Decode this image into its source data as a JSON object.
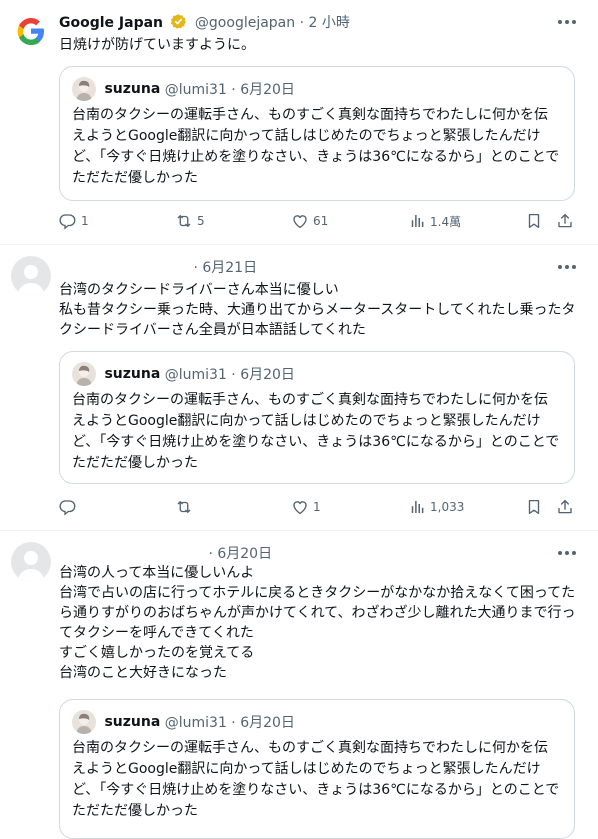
{
  "tweets": [
    {
      "author": "Google Japan",
      "meta": "@googlejapan · 2 小時",
      "text": "日焼けが防げていますように。",
      "quote": {
        "name": "suzuna",
        "meta": "@lumi31 · 6月20日",
        "text": "台南のタクシーの運転手さん、ものすごく真剣な面持ちでわたしに何かを伝えようとGoogle翻訳に向かって話しはじめたのでちょっと緊張したんだけど、「今すぐ日焼け止めを塗りなさい、きょうは36℃になるから」とのことでただただ優しかった"
      },
      "actions": {
        "replies": "1",
        "reposts": "5",
        "likes": "61",
        "views": "1.4萬"
      }
    },
    {
      "meta": "· 6月21日",
      "text": "台湾のタクシードライバーさん本当に優しい\n私も昔タクシー乗った時、大通り出てからメータースタートしてくれたし乗ったタクシードライバーさん全員が日本語話してくれた",
      "quote": {
        "name": "suzuna",
        "meta": "@lumi31 · 6月20日",
        "text": "台南のタクシーの運転手さん、ものすごく真剣な面持ちでわたしに何かを伝えようとGoogle翻訳に向かって話しはじめたのでちょっと緊張したんだけど、「今すぐ日焼け止めを塗りなさい、きょうは36℃になるから」とのことでただただ優しかった"
      },
      "actions": {
        "replies": "",
        "reposts": "",
        "likes": "1",
        "views": "1,033"
      }
    },
    {
      "meta": "· 6月20日",
      "text": "台湾の人って本当に優しいんよ\n台湾で占いの店に行ってホテルに戻るときタクシーがなかなか拾えなくて困ってたら通りすがりのおばちゃんが声かけてくれて、わざわざ少し離れた大通りまで行ってタクシーを呼んできてくれた\nすごく嬉しかったのを覚えてる\n台湾のこと大好きになった",
      "quote": {
        "name": "suzuna",
        "meta": "@lumi31 · 6月20日",
        "text": "台南のタクシーの運転手さん、ものすごく真剣な面持ちでわたしに何かを伝えようとGoogle翻訳に向かって話しはじめたのでちょっと緊張したんだけど、「今すぐ日焼け止めを塗りなさい、きょうは36℃になるから」とのことでただただ優しかった"
      }
    }
  ],
  "colors": {
    "text": "#0f1419",
    "muted": "#536471",
    "border": "#cfd9de",
    "verified_gold": "#e2b719"
  },
  "icons": [
    "google-logo-icon",
    "verified-gold-badge-icon",
    "more-icon",
    "reply-icon",
    "repost-icon",
    "like-icon",
    "views-icon",
    "bookmark-icon",
    "share-icon"
  ]
}
